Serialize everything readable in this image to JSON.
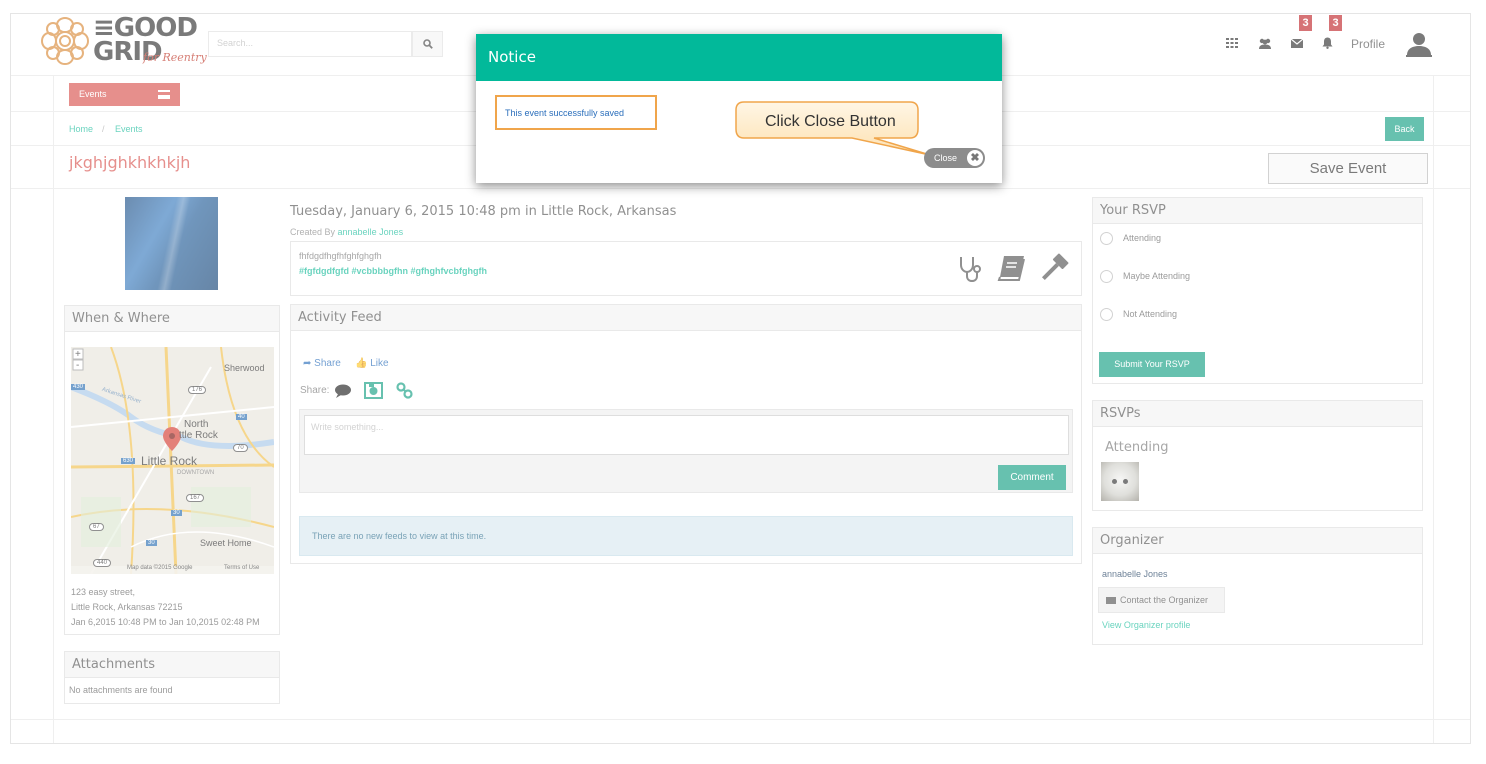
{
  "header": {
    "logo_main": "≡GOOD GRID",
    "logo_sub": "for Reentry",
    "search_placeholder": "Search...",
    "messages_badge": "3",
    "notifications_badge": "3",
    "profile_label": "Profile"
  },
  "nav": {
    "events_label": "Events",
    "breadcrumb_home": "Home",
    "breadcrumb_sep": "/",
    "breadcrumb_events": "Events",
    "back_label": "Back"
  },
  "event": {
    "title": "jkghjghkhkhkjh",
    "save_label": "Save Event",
    "datetime": "Tuesday, January 6, 2015 10:48 pm in Little Rock, Arkansas",
    "created_by_prefix": "Created By ",
    "created_by_name": "annabelle Jones",
    "description": "fhfdgdfhgfhfghfghgfh",
    "hashtags": "#fgfdgdfgfd #vcbbbbgfhn #gfhghfvcbfghgfh",
    "category_icons": [
      "stethoscope-icon",
      "book-icon",
      "gavel-icon"
    ]
  },
  "when_where": {
    "heading": "When & Where",
    "map_labels": {
      "sherwood": "Sherwood",
      "north": "North",
      "ttle_rock": "ttle Rock",
      "little_rock": "Little Rock",
      "downtown": "DOWNTOWN",
      "sweet_home": "Sweet Home",
      "arkansas_river": "Arkansas River",
      "map_data": "Map data ©2015 Google",
      "terms": "Terms of Use",
      "shields": [
        "430",
        "176",
        "40",
        "70",
        "630",
        "167",
        "30",
        "67",
        "30",
        "440"
      ]
    },
    "address1": "123 easy street,",
    "address2": "Little Rock, Arkansas 72215",
    "dates": "Jan 6,2015 10:48 PM to Jan 10,2015 02:48 PM"
  },
  "attachments": {
    "heading": "Attachments",
    "empty": "No attachments are found"
  },
  "activity": {
    "heading": "Activity Feed",
    "share_link": "Share",
    "like_link": "Like",
    "share_label": "Share:",
    "placeholder": "Write something...",
    "comment_label": "Comment",
    "no_feeds": "There are no new feeds to view at this time."
  },
  "rsvp": {
    "heading": "Your RSVP",
    "options": [
      "Attending",
      "Maybe Attending",
      "Not Attending"
    ],
    "submit_label": "Submit Your RSVP"
  },
  "rsvps": {
    "heading": "RSVPs",
    "attending": "Attending"
  },
  "organizer": {
    "heading": "Organizer",
    "name": "annabelle Jones",
    "contact_label": "Contact the Organizer",
    "profile_link": "View Organizer profile"
  },
  "modal": {
    "title": "Notice",
    "message": "This event successfully saved",
    "callout": "Click Close Button",
    "close_label": "Close"
  },
  "colors": {
    "teal": "#02b99a",
    "teal_dark": "#16a085",
    "red": "#d9534f",
    "highlight_orange": "#f0a54b"
  }
}
